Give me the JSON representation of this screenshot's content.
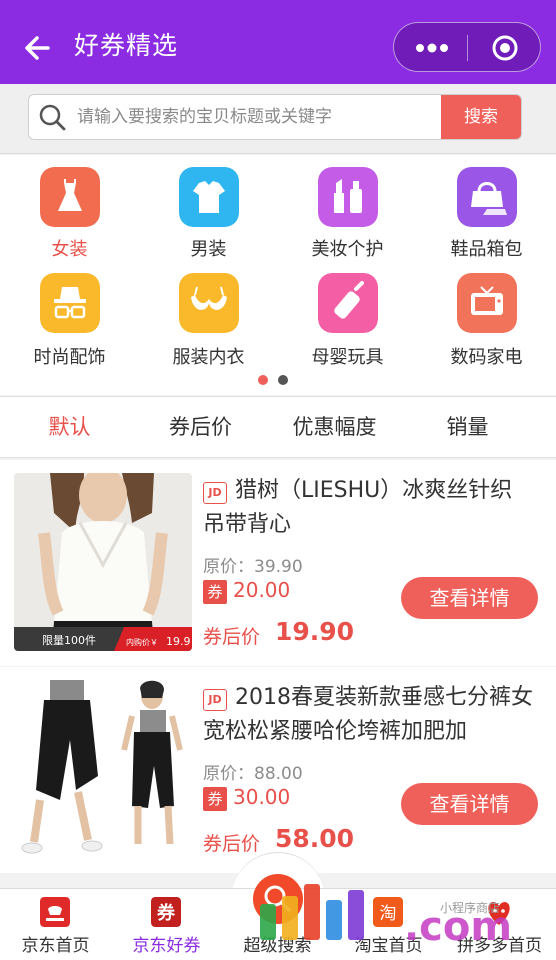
{
  "header": {
    "title": "好券精选",
    "back_icon": "back-arrow-icon",
    "more_icon": "more-dots-icon",
    "close_icon": "target-circle-icon",
    "bg_color": "#8b2be2"
  },
  "search": {
    "placeholder": "请输入要搜索的宝贝标题或关键字",
    "button_label": "搜索"
  },
  "categories": [
    {
      "label": "女装",
      "icon": "dress-icon",
      "color": "#f26d4f",
      "active": true
    },
    {
      "label": "男装",
      "icon": "tshirt-icon",
      "color": "#2fb5f0"
    },
    {
      "label": "美妆个护",
      "icon": "cosmetics-icon",
      "color": "#c45ce8"
    },
    {
      "label": "鞋品箱包",
      "icon": "bag-shoe-icon",
      "color": "#9a56e6"
    },
    {
      "label": "时尚配饰",
      "icon": "hat-glasses-icon",
      "color": "#f9b92a"
    },
    {
      "label": "服装内衣",
      "icon": "underwear-icon",
      "color": "#f9b92a"
    },
    {
      "label": "母婴玩具",
      "icon": "baby-bottle-icon",
      "color": "#f45ea5"
    },
    {
      "label": "数码家电",
      "icon": "tv-icon",
      "color": "#f0735a"
    }
  ],
  "sort_tabs": [
    "默认",
    "券后价",
    "优惠幅度",
    "销量"
  ],
  "products": [
    {
      "badge": "JD",
      "title": "猎树（LIESHU）冰爽丝针织吊带背心",
      "orig_label": "原价：",
      "orig_price": "39.90",
      "coupon_tag": "券",
      "coupon": "20.00",
      "after_label": "券后价",
      "after_price": "19.90",
      "button": "查看详情",
      "image_tag": "限量100件",
      "image_price_label": "内购价￥",
      "image_price": "19.9",
      "image": "white-knit-tank-top-photo"
    },
    {
      "badge": "JD",
      "title": "2018春夏装新款垂感七分裤女宽松松紧腰哈伦垮裤加肥加",
      "orig_label": "原价：",
      "orig_price": "88.00",
      "coupon_tag": "券",
      "coupon": "30.00",
      "after_label": "券后价",
      "after_price": "58.00",
      "button": "查看详情",
      "image": "black-cropped-pants-photo"
    }
  ],
  "tabbar": [
    {
      "label": "京东首页",
      "icon": "jd-icon",
      "color": "#e02a2a"
    },
    {
      "label": "京东好券",
      "icon": "coupon-icon",
      "color": "#c21f1f",
      "active": true,
      "glyph": "券"
    },
    {
      "label": "超级搜索",
      "icon": "super-search-icon",
      "color": "#f04a2a"
    },
    {
      "label": "淘宝首页",
      "icon": "taobao-icon",
      "color": "#f05a1a",
      "glyph": "淘"
    },
    {
      "label": "拼多多首页",
      "icon": "pinduoduo-icon",
      "color": "#e02e24"
    }
  ],
  "watermark": {
    "text": ".com",
    "caption": "小程序商店"
  }
}
